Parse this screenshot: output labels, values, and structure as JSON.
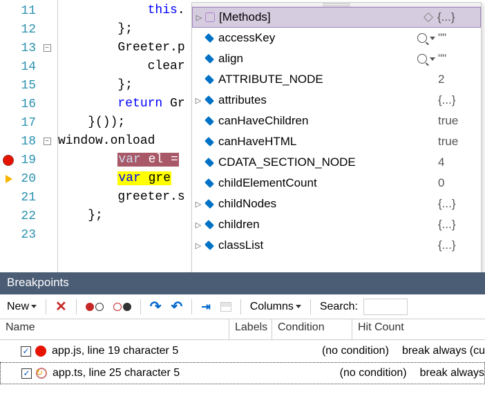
{
  "editor": {
    "lines": [
      {
        "num": "11",
        "fold": null,
        "code": "            this."
      },
      {
        "num": "12",
        "fold": null,
        "code": "        };"
      },
      {
        "num": "13",
        "fold": "-",
        "code": "        Greeter.p"
      },
      {
        "num": "14",
        "fold": null,
        "code": "            clear"
      },
      {
        "num": "15",
        "fold": null,
        "code": "        };"
      },
      {
        "num": "16",
        "fold": null,
        "code": "        return Gr",
        "keyword": "return"
      },
      {
        "num": "17",
        "fold": null,
        "code": "    }());"
      },
      {
        "num": "18",
        "fold": "-",
        "code": "window.onload"
      },
      {
        "num": "19",
        "fold": null,
        "code": "        var el =",
        "hl": "red",
        "glyph": "bp"
      },
      {
        "num": "20",
        "fold": null,
        "code": "        var gre",
        "hl": "yellow",
        "glyph": "arrow"
      },
      {
        "num": "21",
        "fold": null,
        "code": "        greeter.s"
      },
      {
        "num": "22",
        "fold": null,
        "code": "    };"
      },
      {
        "num": "23",
        "fold": null,
        "code": ""
      }
    ]
  },
  "tooltip": {
    "rows": [
      {
        "expand": "▷",
        "icon": "hex",
        "name": "[Methods]",
        "val": "{...}",
        "sel": true,
        "pin": true
      },
      {
        "expand": "",
        "icon": "cube",
        "name": "accessKey",
        "val": "\"\"",
        "search": true
      },
      {
        "expand": "",
        "icon": "cube",
        "name": "align",
        "val": "\"\"",
        "search": true
      },
      {
        "expand": "",
        "icon": "cube",
        "name": "ATTRIBUTE_NODE",
        "val": "2"
      },
      {
        "expand": "▷",
        "icon": "cube",
        "name": "attributes",
        "val": "{...}"
      },
      {
        "expand": "",
        "icon": "cube",
        "name": "canHaveChildren",
        "val": "true"
      },
      {
        "expand": "",
        "icon": "cube",
        "name": "canHaveHTML",
        "val": "true"
      },
      {
        "expand": "",
        "icon": "cube",
        "name": "CDATA_SECTION_NODE",
        "val": "4"
      },
      {
        "expand": "",
        "icon": "cube",
        "name": "childElementCount",
        "val": "0"
      },
      {
        "expand": "▷",
        "icon": "cube",
        "name": "childNodes",
        "val": "{...}"
      },
      {
        "expand": "▷",
        "icon": "cube",
        "name": "children",
        "val": "{...}"
      },
      {
        "expand": "▷",
        "icon": "cube",
        "name": "classList",
        "val": "{...}"
      }
    ]
  },
  "breakpoints": {
    "title": "Breakpoints",
    "toolbar": {
      "new": "New",
      "columns": "Columns",
      "search_label": "Search:",
      "search_value": ""
    },
    "headers": {
      "name": "Name",
      "labels": "Labels",
      "condition": "Condition",
      "hit": "Hit Count"
    },
    "rows": [
      {
        "icon": "red",
        "name": "app.js, line 19 character 5",
        "labels": "",
        "cond": "(no condition)",
        "hit": "break always (cu",
        "sel": false
      },
      {
        "icon": "map",
        "name": "app.ts, line 25 character 5",
        "labels": "",
        "cond": "(no condition)",
        "hit": "break always",
        "sel": true
      }
    ],
    "scroll_arrow_hint": "▾"
  }
}
